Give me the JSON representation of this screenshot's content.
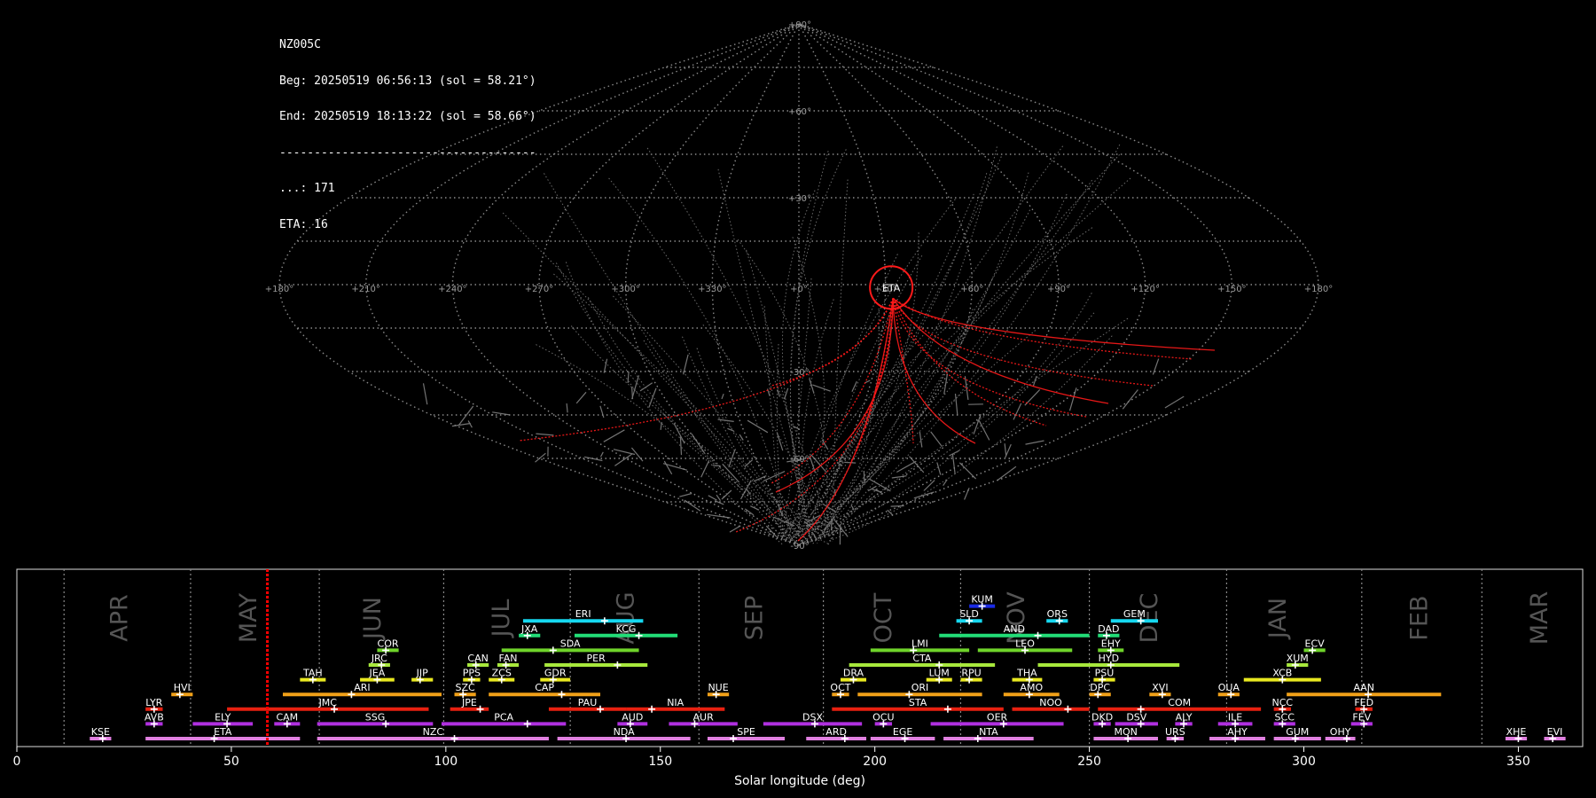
{
  "info": {
    "station": "NZ005C",
    "begin": "Beg: 20250519 06:56:13 (sol = 58.21°)",
    "end": "End: 20250519 18:13:22 (sol = 58.66°)",
    "separator": "-------------------------------------",
    "sporadic": "...: 171",
    "eta": "ETA: 16"
  },
  "colors": {
    "background": "#000000",
    "grid": "#8a8a8a",
    "shower_highlight": "#ff1a1a",
    "sporadic": "#888888",
    "current_sol": "#ff0000"
  },
  "chart_data": [
    {
      "type": "scatter",
      "projection": "sinusoidal",
      "lon_grid_labels": [
        "+180°",
        "+150°",
        "+120°",
        "+90°",
        "+60°",
        "+30°",
        "+0°",
        "+330°",
        "+300°",
        "+270°",
        "+240°",
        "+210°",
        "+180°"
      ],
      "lat_grid_labels": [
        "+90°",
        "+60°",
        "+30°",
        "-30°",
        "-60°",
        "-90°"
      ],
      "highlighted_radiant": {
        "code": "ETA",
        "lon": -32,
        "lat": -1
      }
    },
    {
      "type": "timeline",
      "xlabel": "Solar longitude (deg)",
      "xlim": [
        0,
        365
      ],
      "xticks": [
        0,
        50,
        100,
        150,
        200,
        250,
        300,
        350
      ],
      "current_sol": 58.4,
      "months": [
        {
          "label": "APR",
          "x": 24
        },
        {
          "label": "MAY",
          "x": 54
        },
        {
          "label": "JUN",
          "x": 83
        },
        {
          "label": "JUL",
          "x": 113
        },
        {
          "label": "AUG",
          "x": 142
        },
        {
          "label": "SEP",
          "x": 172
        },
        {
          "label": "OCT",
          "x": 202
        },
        {
          "label": "NOV",
          "x": 233
        },
        {
          "label": "DEC",
          "x": 264
        },
        {
          "label": "JAN",
          "x": 294
        },
        {
          "label": "FEB",
          "x": 327
        },
        {
          "label": "MAR",
          "x": 355
        }
      ],
      "month_boundaries": [
        11,
        40.5,
        70.5,
        99.5,
        129,
        159,
        188,
        220,
        250,
        282,
        313.5,
        341.5
      ],
      "showers": [
        {
          "code": "KUM",
          "start": 222,
          "end": 228,
          "peak": 225,
          "row": 9,
          "color": "#1a2ae6"
        },
        {
          "code": "ERI",
          "start": 118,
          "end": 146,
          "peak": 137,
          "row": 8,
          "color": "#16d8f0"
        },
        {
          "code": "SLD",
          "start": 219,
          "end": 225,
          "peak": 222,
          "row": 8,
          "color": "#16d8f0"
        },
        {
          "code": "ORS",
          "start": 240,
          "end": 245,
          "peak": 243,
          "row": 8,
          "color": "#16d8f0"
        },
        {
          "code": "GEM",
          "start": 255,
          "end": 266,
          "peak": 262,
          "row": 8,
          "color": "#16d8f0"
        },
        {
          "code": "JXA",
          "start": 117,
          "end": 122,
          "peak": 119,
          "row": 7,
          "color": "#22dd77"
        },
        {
          "code": "KCG",
          "start": 130,
          "end": 154,
          "peak": 145,
          "row": 7,
          "color": "#22dd77"
        },
        {
          "code": "AND",
          "start": 215,
          "end": 250,
          "peak": 238,
          "row": 7,
          "color": "#22dd77"
        },
        {
          "code": "DAD",
          "start": 252,
          "end": 257,
          "peak": 254,
          "row": 7,
          "color": "#22dd77"
        },
        {
          "code": "COR",
          "start": 84,
          "end": 89,
          "peak": 86,
          "row": 6,
          "color": "#6fd42a"
        },
        {
          "code": "SDA",
          "start": 113,
          "end": 145,
          "peak": 125,
          "row": 6,
          "color": "#6fd42a"
        },
        {
          "code": "LMI",
          "start": 199,
          "end": 222,
          "peak": 209,
          "row": 6,
          "color": "#6fd42a"
        },
        {
          "code": "LEO",
          "start": 224,
          "end": 246,
          "peak": 235,
          "row": 6,
          "color": "#6fd42a"
        },
        {
          "code": "EHY",
          "start": 252,
          "end": 258,
          "peak": 255,
          "row": 6,
          "color": "#6fd42a"
        },
        {
          "code": "ECV",
          "start": 300,
          "end": 305,
          "peak": 302,
          "row": 6,
          "color": "#6fd42a"
        },
        {
          "code": "JRC",
          "start": 82,
          "end": 87,
          "peak": 85,
          "row": 5,
          "color": "#a8e83c"
        },
        {
          "code": "CAN",
          "start": 105,
          "end": 110,
          "peak": 107,
          "row": 5,
          "color": "#a8e83c"
        },
        {
          "code": "FAN",
          "start": 112,
          "end": 117,
          "peak": 114,
          "row": 5,
          "color": "#a8e83c"
        },
        {
          "code": "PER",
          "start": 123,
          "end": 147,
          "peak": 140,
          "row": 5,
          "color": "#a8e83c"
        },
        {
          "code": "CTA",
          "start": 194,
          "end": 228,
          "peak": 215,
          "row": 5,
          "color": "#a8e83c"
        },
        {
          "code": "HYD",
          "start": 238,
          "end": 271,
          "peak": 255,
          "row": 5,
          "color": "#a8e83c"
        },
        {
          "code": "XUM",
          "start": 296,
          "end": 301,
          "peak": 298,
          "row": 5,
          "color": "#a8e83c"
        },
        {
          "code": "TAH",
          "start": 66,
          "end": 72,
          "peak": 69,
          "row": 4,
          "color": "#e8e820"
        },
        {
          "code": "JEA",
          "start": 80,
          "end": 88,
          "peak": 84,
          "row": 4,
          "color": "#e8e820"
        },
        {
          "code": "JIP",
          "start": 92,
          "end": 97,
          "peak": 94,
          "row": 4,
          "color": "#e8e820"
        },
        {
          "code": "PPS",
          "start": 104,
          "end": 108,
          "peak": 106,
          "row": 4,
          "color": "#e8e820"
        },
        {
          "code": "ZCS",
          "start": 110,
          "end": 116,
          "peak": 113,
          "row": 4,
          "color": "#e8e820"
        },
        {
          "code": "GDR",
          "start": 122,
          "end": 129,
          "peak": 125,
          "row": 4,
          "color": "#e8e820"
        },
        {
          "code": "DRA",
          "start": 192,
          "end": 198,
          "peak": 195,
          "row": 4,
          "color": "#e8e820"
        },
        {
          "code": "LUM",
          "start": 212,
          "end": 218,
          "peak": 215,
          "row": 4,
          "color": "#e8e820"
        },
        {
          "code": "RPU",
          "start": 220,
          "end": 225,
          "peak": 222,
          "row": 4,
          "color": "#e8e820"
        },
        {
          "code": "THA",
          "start": 232,
          "end": 239,
          "peak": 236,
          "row": 4,
          "color": "#e8e820"
        },
        {
          "code": "PSU",
          "start": 251,
          "end": 256,
          "peak": 253,
          "row": 4,
          "color": "#e8e820"
        },
        {
          "code": "XCB",
          "start": 286,
          "end": 304,
          "peak": 295,
          "row": 4,
          "color": "#e8e820"
        },
        {
          "code": "HVI",
          "start": 36,
          "end": 41,
          "peak": 38,
          "row": 3,
          "color": "#f0a018"
        },
        {
          "code": "ARI",
          "start": 62,
          "end": 99,
          "peak": 78,
          "row": 3,
          "color": "#f0a018"
        },
        {
          "code": "SZC",
          "start": 102,
          "end": 107,
          "peak": 104,
          "row": 3,
          "color": "#f0a018"
        },
        {
          "code": "CAP",
          "start": 110,
          "end": 136,
          "peak": 127,
          "row": 3,
          "color": "#f0a018"
        },
        {
          "code": "NUE",
          "start": 161,
          "end": 166,
          "peak": 163,
          "row": 3,
          "color": "#f0a018"
        },
        {
          "code": "OCT",
          "start": 190,
          "end": 194,
          "peak": 192,
          "row": 3,
          "color": "#f0a018"
        },
        {
          "code": "ORI",
          "start": 196,
          "end": 225,
          "peak": 208,
          "row": 3,
          "color": "#f0a018"
        },
        {
          "code": "AMO",
          "start": 230,
          "end": 243,
          "peak": 236,
          "row": 3,
          "color": "#f0a018"
        },
        {
          "code": "DPC",
          "start": 250,
          "end": 255,
          "peak": 252,
          "row": 3,
          "color": "#f0a018"
        },
        {
          "code": "XVI",
          "start": 264,
          "end": 269,
          "peak": 267,
          "row": 3,
          "color": "#f0a018"
        },
        {
          "code": "OUA",
          "start": 280,
          "end": 285,
          "peak": 283,
          "row": 3,
          "color": "#f0a018"
        },
        {
          "code": "AAN",
          "start": 296,
          "end": 332,
          "peak": 315,
          "row": 3,
          "color": "#f0a018"
        },
        {
          "code": "LYR",
          "start": 30,
          "end": 34,
          "peak": 32,
          "row": 2,
          "color": "#e82010"
        },
        {
          "code": "JMC",
          "start": 49,
          "end": 96,
          "peak": 74,
          "row": 2,
          "color": "#e82010"
        },
        {
          "code": "JPE",
          "start": 101,
          "end": 110,
          "peak": 108,
          "row": 2,
          "color": "#e82010"
        },
        {
          "code": "PAU",
          "start": 124,
          "end": 142,
          "peak": 136,
          "row": 2,
          "color": "#e82010"
        },
        {
          "code": "NIA",
          "start": 142,
          "end": 165,
          "peak": 148,
          "row": 2,
          "color": "#e82010"
        },
        {
          "code": "STA",
          "start": 190,
          "end": 230,
          "peak": 217,
          "row": 2,
          "color": "#e82010"
        },
        {
          "code": "NOO",
          "start": 232,
          "end": 250,
          "peak": 245,
          "row": 2,
          "color": "#e82010"
        },
        {
          "code": "COM",
          "start": 252,
          "end": 290,
          "peak": 262,
          "row": 2,
          "color": "#e82010"
        },
        {
          "code": "NCC",
          "start": 293,
          "end": 297,
          "peak": 295,
          "row": 2,
          "color": "#e82010"
        },
        {
          "code": "FED",
          "start": 312,
          "end": 316,
          "peak": 314,
          "row": 2,
          "color": "#e82010"
        },
        {
          "code": "AVB",
          "start": 30,
          "end": 34,
          "peak": 32,
          "row": 1,
          "color": "#b030e0"
        },
        {
          "code": "ELY",
          "start": 41,
          "end": 55,
          "peak": 49,
          "row": 1,
          "color": "#b030e0"
        },
        {
          "code": "CAM",
          "start": 60,
          "end": 66,
          "peak": 63,
          "row": 1,
          "color": "#b030e0"
        },
        {
          "code": "SSG",
          "start": 70,
          "end": 97,
          "peak": 86,
          "row": 1,
          "color": "#b030e0"
        },
        {
          "code": "PCA",
          "start": 99,
          "end": 128,
          "peak": 119,
          "row": 1,
          "color": "#b030e0"
        },
        {
          "code": "AUD",
          "start": 140,
          "end": 147,
          "peak": 143,
          "row": 1,
          "color": "#b030e0"
        },
        {
          "code": "AUR",
          "start": 152,
          "end": 168,
          "peak": 158,
          "row": 1,
          "color": "#b030e0"
        },
        {
          "code": "DSX",
          "start": 174,
          "end": 197,
          "peak": 186,
          "row": 1,
          "color": "#b030e0"
        },
        {
          "code": "OCU",
          "start": 200,
          "end": 204,
          "peak": 202,
          "row": 1,
          "color": "#b030e0"
        },
        {
          "code": "OER",
          "start": 213,
          "end": 244,
          "peak": 230,
          "row": 1,
          "color": "#b030e0"
        },
        {
          "code": "DKD",
          "start": 251,
          "end": 255,
          "peak": 253,
          "row": 1,
          "color": "#b030e0"
        },
        {
          "code": "DSV",
          "start": 256,
          "end": 266,
          "peak": 262,
          "row": 1,
          "color": "#b030e0"
        },
        {
          "code": "ALY",
          "start": 270,
          "end": 274,
          "peak": 272,
          "row": 1,
          "color": "#b030e0"
        },
        {
          "code": "ILE",
          "start": 280,
          "end": 288,
          "peak": 284,
          "row": 1,
          "color": "#b030e0"
        },
        {
          "code": "SCC",
          "start": 293,
          "end": 298,
          "peak": 295,
          "row": 1,
          "color": "#b030e0"
        },
        {
          "code": "FEV",
          "start": 311,
          "end": 316,
          "peak": 314,
          "row": 1,
          "color": "#b030e0"
        },
        {
          "code": "KSE",
          "start": 17,
          "end": 22,
          "peak": 20,
          "row": 0,
          "color": "#e080e0"
        },
        {
          "code": "ETA",
          "start": 30,
          "end": 66,
          "peak": 46,
          "row": 0,
          "color": "#e080e0"
        },
        {
          "code": "NZC",
          "start": 70,
          "end": 124,
          "peak": 102,
          "row": 0,
          "color": "#e080e0"
        },
        {
          "code": "NDA",
          "start": 126,
          "end": 157,
          "peak": 142,
          "row": 0,
          "color": "#e080e0"
        },
        {
          "code": "SPE",
          "start": 161,
          "end": 179,
          "peak": 167,
          "row": 0,
          "color": "#e080e0"
        },
        {
          "code": "ARD",
          "start": 184,
          "end": 198,
          "peak": 193,
          "row": 0,
          "color": "#e080e0"
        },
        {
          "code": "EGE",
          "start": 199,
          "end": 214,
          "peak": 207,
          "row": 0,
          "color": "#e080e0"
        },
        {
          "code": "NTA",
          "start": 216,
          "end": 237,
          "peak": 224,
          "row": 0,
          "color": "#e080e0"
        },
        {
          "code": "MON",
          "start": 251,
          "end": 266,
          "peak": 259,
          "row": 0,
          "color": "#e080e0"
        },
        {
          "code": "URS",
          "start": 268,
          "end": 272,
          "peak": 270,
          "row": 0,
          "color": "#e080e0"
        },
        {
          "code": "AHY",
          "start": 278,
          "end": 291,
          "peak": 284,
          "row": 0,
          "color": "#e080e0"
        },
        {
          "code": "GUM",
          "start": 293,
          "end": 304,
          "peak": 298,
          "row": 0,
          "color": "#e080e0"
        },
        {
          "code": "OHY",
          "start": 305,
          "end": 312,
          "peak": 310,
          "row": 0,
          "color": "#e080e0"
        },
        {
          "code": "XHE",
          "start": 347,
          "end": 352,
          "peak": 350,
          "row": 0,
          "color": "#e080e0"
        },
        {
          "code": "EVI",
          "start": 356,
          "end": 361,
          "peak": 358,
          "row": 0,
          "color": "#e080e0"
        }
      ]
    }
  ]
}
